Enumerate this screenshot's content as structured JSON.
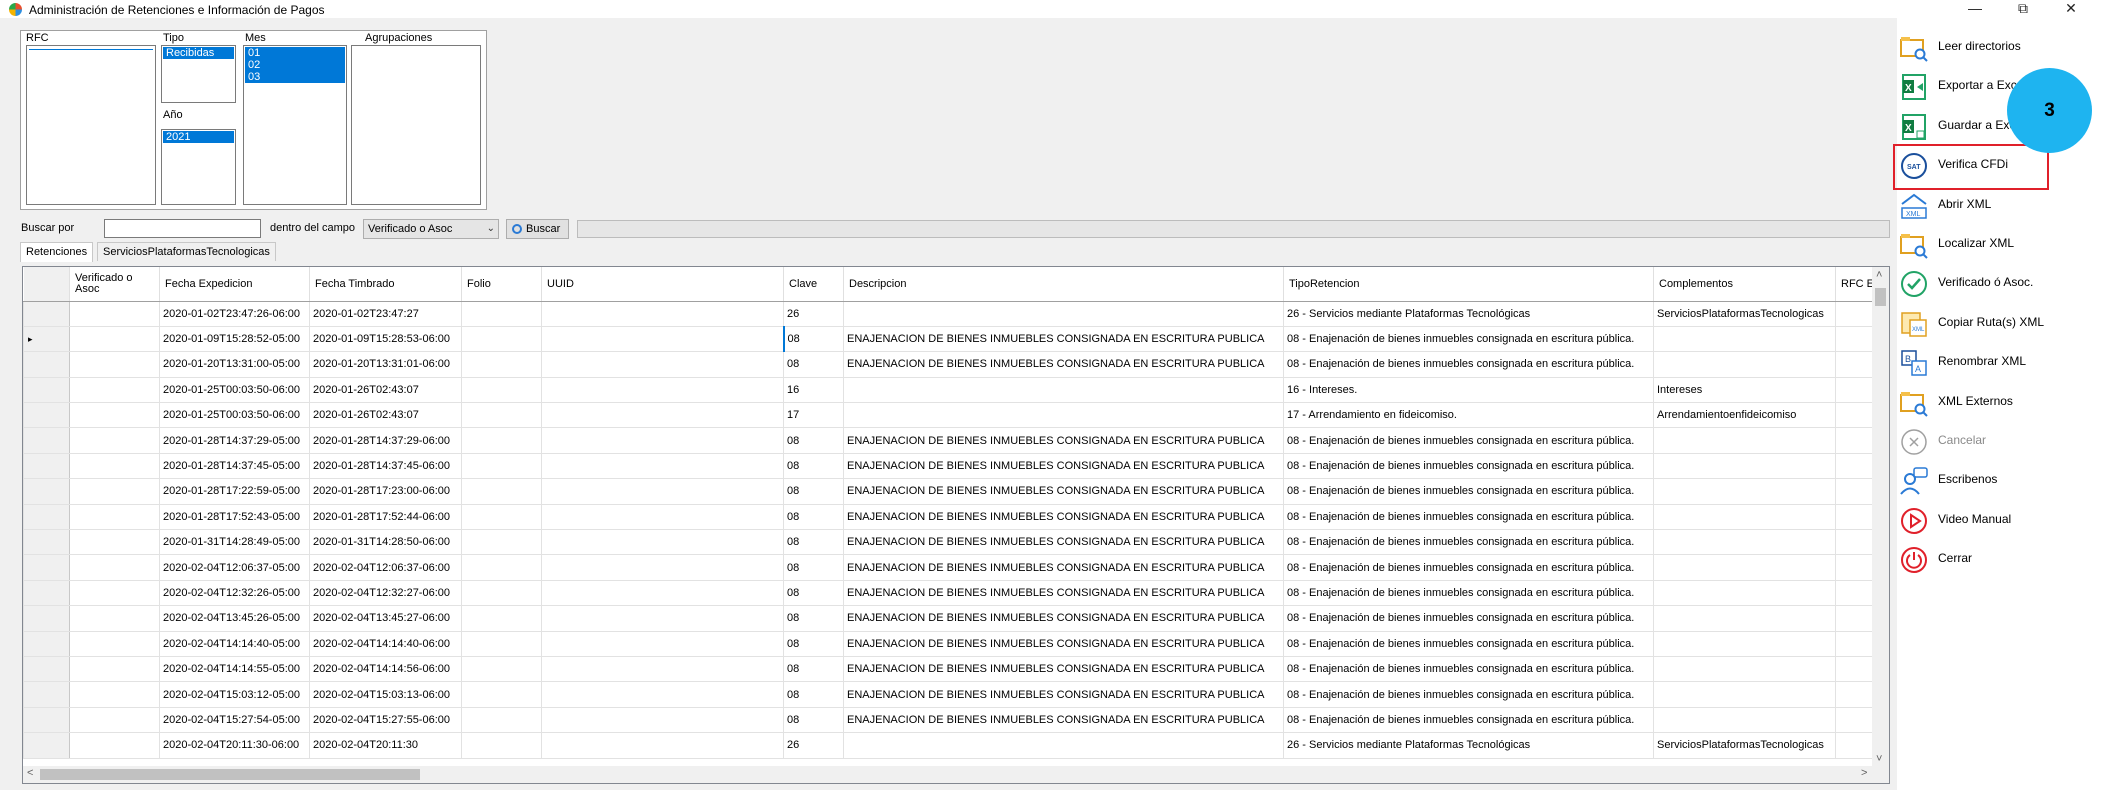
{
  "window": {
    "title": "Administración de Retenciones e Información de Pagos",
    "minimize": "—",
    "restore": "⧉",
    "close": "✕"
  },
  "filters": {
    "rfc_label": "RFC",
    "tipo_label": "Tipo",
    "tipo_selected": "Recibidas",
    "anio_label": "Año",
    "anio_selected": "2021",
    "mes_label": "Mes",
    "mes_items": [
      "01",
      "02",
      "03"
    ],
    "agrupaciones_label": "Agrupaciones"
  },
  "search": {
    "buscar_por_label": "Buscar por",
    "value": "",
    "dentro_label": "dentro del campo",
    "field_selected": "Verificado o Asoc",
    "button_label": "Buscar"
  },
  "tabs": [
    "Retenciones",
    "ServiciosPlataformasTecnologicas"
  ],
  "grid": {
    "columns": [
      "Verificado o Asoc",
      "Fecha Expedicion",
      "Fecha Timbrado",
      "Folio",
      "UUID",
      "Clave",
      "Descripcion",
      "TipoRetencion",
      "Complementos",
      "RFC E"
    ],
    "rows": [
      [
        "",
        "2020-01-02T23:47:26-06:00",
        "2020-01-02T23:47:27",
        "",
        "",
        "26",
        "",
        "26 - Servicios mediante Plataformas Tecnológicas",
        "ServiciosPlataformasTecnologicas",
        ""
      ],
      [
        "",
        "2020-01-09T15:28:52-05:00",
        "2020-01-09T15:28:53-06:00",
        "",
        "",
        "08",
        "ENAJENACION DE BIENES INMUEBLES CONSIGNADA EN ESCRITURA PUBLICA",
        "08 - Enajenación de bienes inmuebles consignada en escritura pública.",
        "",
        ""
      ],
      [
        "",
        "2020-01-20T13:31:00-05:00",
        "2020-01-20T13:31:01-06:00",
        "",
        "",
        "08",
        "ENAJENACION DE BIENES INMUEBLES CONSIGNADA EN ESCRITURA PUBLICA",
        "08 - Enajenación de bienes inmuebles consignada en escritura pública.",
        "",
        ""
      ],
      [
        "",
        "2020-01-25T00:03:50-06:00",
        "2020-01-26T02:43:07",
        "",
        "",
        "16",
        "",
        "16 - Intereses.",
        "Intereses",
        ""
      ],
      [
        "",
        "2020-01-25T00:03:50-06:00",
        "2020-01-26T02:43:07",
        "",
        "",
        "17",
        "",
        "17 - Arrendamiento en fideicomiso.",
        "Arrendamientoenfideicomiso",
        ""
      ],
      [
        "",
        "2020-01-28T14:37:29-05:00",
        "2020-01-28T14:37:29-06:00",
        "",
        "",
        "08",
        "ENAJENACION DE BIENES INMUEBLES CONSIGNADA EN ESCRITURA PUBLICA",
        "08 - Enajenación de bienes inmuebles consignada en escritura pública.",
        "",
        ""
      ],
      [
        "",
        "2020-01-28T14:37:45-05:00",
        "2020-01-28T14:37:45-06:00",
        "",
        "",
        "08",
        "ENAJENACION DE BIENES INMUEBLES CONSIGNADA EN ESCRITURA PUBLICA",
        "08 - Enajenación de bienes inmuebles consignada en escritura pública.",
        "",
        ""
      ],
      [
        "",
        "2020-01-28T17:22:59-05:00",
        "2020-01-28T17:23:00-06:00",
        "",
        "",
        "08",
        "ENAJENACION DE BIENES INMUEBLES CONSIGNADA EN ESCRITURA PUBLICA",
        "08 - Enajenación de bienes inmuebles consignada en escritura pública.",
        "",
        ""
      ],
      [
        "",
        "2020-01-28T17:52:43-05:00",
        "2020-01-28T17:52:44-06:00",
        "",
        "",
        "08",
        "ENAJENACION DE BIENES INMUEBLES CONSIGNADA EN ESCRITURA PUBLICA",
        "08 - Enajenación de bienes inmuebles consignada en escritura pública.",
        "",
        ""
      ],
      [
        "",
        "2020-01-31T14:28:49-05:00",
        "2020-01-31T14:28:50-06:00",
        "",
        "",
        "08",
        "ENAJENACION DE BIENES INMUEBLES CONSIGNADA EN ESCRITURA PUBLICA",
        "08 - Enajenación de bienes inmuebles consignada en escritura pública.",
        "",
        ""
      ],
      [
        "",
        "2020-02-04T12:06:37-05:00",
        "2020-02-04T12:06:37-06:00",
        "",
        "",
        "08",
        "ENAJENACION DE BIENES INMUEBLES CONSIGNADA EN ESCRITURA PUBLICA",
        "08 - Enajenación de bienes inmuebles consignada en escritura pública.",
        "",
        ""
      ],
      [
        "",
        "2020-02-04T12:32:26-05:00",
        "2020-02-04T12:32:27-06:00",
        "",
        "",
        "08",
        "ENAJENACION DE BIENES INMUEBLES CONSIGNADA EN ESCRITURA PUBLICA",
        "08 - Enajenación de bienes inmuebles consignada en escritura pública.",
        "",
        ""
      ],
      [
        "",
        "2020-02-04T13:45:26-05:00",
        "2020-02-04T13:45:27-06:00",
        "",
        "",
        "08",
        "ENAJENACION DE BIENES INMUEBLES CONSIGNADA EN ESCRITURA PUBLICA",
        "08 - Enajenación de bienes inmuebles consignada en escritura pública.",
        "",
        ""
      ],
      [
        "",
        "2020-02-04T14:14:40-05:00",
        "2020-02-04T14:14:40-06:00",
        "",
        "",
        "08",
        "ENAJENACION DE BIENES INMUEBLES CONSIGNADA EN ESCRITURA PUBLICA",
        "08 - Enajenación de bienes inmuebles consignada en escritura pública.",
        "",
        ""
      ],
      [
        "",
        "2020-02-04T14:14:55-05:00",
        "2020-02-04T14:14:56-06:00",
        "",
        "",
        "08",
        "ENAJENACION DE BIENES INMUEBLES CONSIGNADA EN ESCRITURA PUBLICA",
        "08 - Enajenación de bienes inmuebles consignada en escritura pública.",
        "",
        ""
      ],
      [
        "",
        "2020-02-04T15:03:12-05:00",
        "2020-02-04T15:03:13-06:00",
        "",
        "",
        "08",
        "ENAJENACION DE BIENES INMUEBLES CONSIGNADA EN ESCRITURA PUBLICA",
        "08 - Enajenación de bienes inmuebles consignada en escritura pública.",
        "",
        ""
      ],
      [
        "",
        "2020-02-04T15:27:54-05:00",
        "2020-02-04T15:27:55-06:00",
        "",
        "",
        "08",
        "ENAJENACION DE BIENES INMUEBLES CONSIGNADA EN ESCRITURA PUBLICA",
        "08 - Enajenación de bienes inmuebles consignada en escritura pública.",
        "",
        ""
      ],
      [
        "",
        "2020-02-04T20:11:30-06:00",
        "2020-02-04T20:11:30",
        "",
        "",
        "26",
        "",
        "26 - Servicios mediante Plataformas Tecnológicas",
        "ServiciosPlataformasTecnologicas",
        ""
      ]
    ]
  },
  "sidebar": [
    {
      "label": "Leer directorios",
      "icon": "folder-search-icon",
      "disabled": false
    },
    {
      "label": "Exportar a Excel",
      "icon": "excel-export-icon",
      "disabled": false
    },
    {
      "label": "Guardar a Excel",
      "icon": "excel-save-icon",
      "disabled": false
    },
    {
      "label": "Verifica CFDi",
      "icon": "sat-verify-icon",
      "disabled": false
    },
    {
      "label": "Abrir XML",
      "icon": "xml-open-icon",
      "disabled": false
    },
    {
      "label": "Localizar  XML",
      "icon": "folder-search-icon",
      "disabled": false
    },
    {
      "label": "Verificado ó Asoc.",
      "icon": "check-circle-icon",
      "disabled": false
    },
    {
      "label": "Copiar Ruta(s) XML",
      "icon": "copy-path-icon",
      "disabled": false
    },
    {
      "label": "Renombrar XML",
      "icon": "rename-icon",
      "disabled": false
    },
    {
      "label": "XML Externos",
      "icon": "folder-search-icon",
      "disabled": false
    },
    {
      "label": "Cancelar",
      "icon": "cancel-icon",
      "disabled": true
    },
    {
      "label": "Escribenos",
      "icon": "chat-person-icon",
      "disabled": false
    },
    {
      "label": "Video Manual",
      "icon": "play-icon",
      "disabled": false
    },
    {
      "label": "Cerrar",
      "icon": "power-icon",
      "disabled": false
    }
  ],
  "callout": {
    "number": "3"
  },
  "colors": {
    "accent": "#0078d7",
    "highlight": "#e0202a",
    "badge": "#1eb4f0"
  }
}
